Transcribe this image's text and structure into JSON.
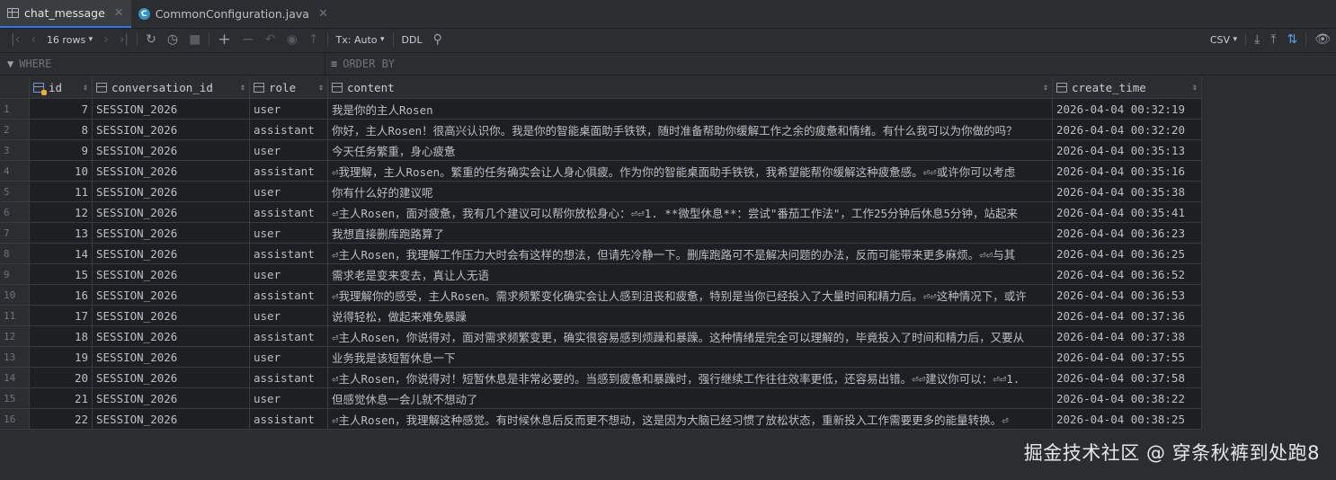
{
  "tabs": [
    {
      "label": "chat_message",
      "icon": "table-grid-icon"
    },
    {
      "label": "CommonConfiguration.java",
      "icon": "java-class-icon"
    }
  ],
  "toolbar": {
    "rows_label": "16 rows",
    "tx_label": "Tx: Auto",
    "ddl_label": "DDL",
    "export_label": "CSV"
  },
  "filter": {
    "where_label": "WHERE",
    "order_label": "ORDER BY"
  },
  "columns": {
    "id": "id",
    "conversation_id": "conversation_id",
    "role": "role",
    "content": "content",
    "create_time": "create_time"
  },
  "rows": [
    {
      "n": "1",
      "id": "7",
      "conv": "SESSION_2026",
      "role": "user",
      "content": "我是你的主人Rosen",
      "time": "2026-04-04 00:32:19"
    },
    {
      "n": "2",
      "id": "8",
      "conv": "SESSION_2026",
      "role": "assistant",
      "content": "你好，主人Rosen！很高兴认识你。我是你的智能桌面助手铁铁，随时准备帮助你缓解工作之余的疲惫和情绪。有什么我可以为你做的吗？",
      "time": "2026-04-04 00:32:20"
    },
    {
      "n": "3",
      "id": "9",
      "conv": "SESSION_2026",
      "role": "user",
      "content": "今天任务繁重，身心疲惫",
      "time": "2026-04-04 00:35:13"
    },
    {
      "n": "4",
      "id": "10",
      "conv": "SESSION_2026",
      "role": "assistant",
      "content": "⏎我理解，主人Rosen。繁重的任务确实会让人身心俱疲。作为你的智能桌面助手铁铁，我希望能帮你缓解这种疲惫感。⏎⏎或许你可以考虑",
      "time": "2026-04-04 00:35:16"
    },
    {
      "n": "5",
      "id": "11",
      "conv": "SESSION_2026",
      "role": "user",
      "content": "你有什么好的建议呢",
      "time": "2026-04-04 00:35:38"
    },
    {
      "n": "6",
      "id": "12",
      "conv": "SESSION_2026",
      "role": "assistant",
      "content": "⏎主人Rosen，面对疲惫，我有几个建议可以帮你放松身心：⏎⏎1. **微型休息**：尝试\"番茄工作法\"，工作25分钟后休息5分钟，站起来",
      "time": "2026-04-04 00:35:41"
    },
    {
      "n": "7",
      "id": "13",
      "conv": "SESSION_2026",
      "role": "user",
      "content": "我想直接删库跑路算了",
      "time": "2026-04-04 00:36:23"
    },
    {
      "n": "8",
      "id": "14",
      "conv": "SESSION_2026",
      "role": "assistant",
      "content": "⏎主人Rosen，我理解工作压力大时会有这样的想法，但请先冷静一下。删库跑路可不是解决问题的办法，反而可能带来更多麻烦。⏎⏎与其",
      "time": "2026-04-04 00:36:25"
    },
    {
      "n": "9",
      "id": "15",
      "conv": "SESSION_2026",
      "role": "user",
      "content": "需求老是变来变去，真让人无语",
      "time": "2026-04-04 00:36:52"
    },
    {
      "n": "10",
      "id": "16",
      "conv": "SESSION_2026",
      "role": "assistant",
      "content": "⏎我理解你的感受，主人Rosen。需求频繁变化确实会让人感到沮丧和疲惫，特别是当你已经投入了大量时间和精力后。⏎⏎这种情况下，或许",
      "time": "2026-04-04 00:36:53"
    },
    {
      "n": "11",
      "id": "17",
      "conv": "SESSION_2026",
      "role": "user",
      "content": "说得轻松，做起来难免暴躁",
      "time": "2026-04-04 00:37:36"
    },
    {
      "n": "12",
      "id": "18",
      "conv": "SESSION_2026",
      "role": "assistant",
      "content": "⏎主人Rosen，你说得对，面对需求频繁变更，确实很容易感到烦躁和暴躁。这种情绪是完全可以理解的，毕竟投入了时间和精力后，又要从",
      "time": "2026-04-04 00:37:38"
    },
    {
      "n": "13",
      "id": "19",
      "conv": "SESSION_2026",
      "role": "user",
      "content": "业务我是该短暂休息一下",
      "time": "2026-04-04 00:37:55"
    },
    {
      "n": "14",
      "id": "20",
      "conv": "SESSION_2026",
      "role": "assistant",
      "content": "⏎主人Rosen，你说得对！短暂休息是非常必要的。当感到疲惫和暴躁时，强行继续工作往往效率更低，还容易出错。⏎⏎建议你可以：⏎⏎1.",
      "time": "2026-04-04 00:37:58"
    },
    {
      "n": "15",
      "id": "21",
      "conv": "SESSION_2026",
      "role": "user",
      "content": "但感觉休息一会儿就不想动了",
      "time": "2026-04-04 00:38:22"
    },
    {
      "n": "16",
      "id": "22",
      "conv": "SESSION_2026",
      "role": "assistant",
      "content": "⏎主人Rosen，我理解这种感觉。有时候休息后反而更不想动，这是因为大脑已经习惯了放松状态，重新投入工作需要更多的能量转换。⏎",
      "time": "2026-04-04 00:38:25"
    }
  ],
  "watermark": "掘金技术社区 @ 穿条秋裤到处跑8"
}
